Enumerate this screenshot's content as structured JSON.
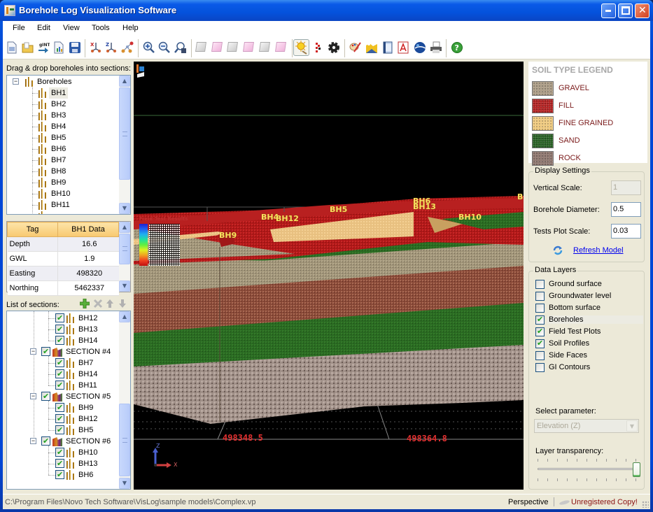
{
  "window": {
    "title": "Borehole Log Visualization Software",
    "minimize": "_",
    "maximize": "□",
    "close": "✕"
  },
  "menu": [
    "File",
    "Edit",
    "View",
    "Tools",
    "Help"
  ],
  "toolbar": {
    "icons": [
      "new-file-icon",
      "open-folder-icon",
      "import-gint-icon",
      "report-icon",
      "save-icon",
      "x-section-icon",
      "z-section-icon",
      "network-icon",
      "zoom-in-icon",
      "zoom-out-icon",
      "zoom-extents-icon",
      "view-cube-front-icon",
      "view-cube-back-icon",
      "view-cube-left-icon",
      "view-cube-right-icon",
      "view-cube-top-icon",
      "view-cube-bottom-icon",
      "lighting-icon",
      "field-plot-icon",
      "settings-gear-icon",
      "palette-brush-icon",
      "export-image-icon",
      "export-video-icon",
      "export-pdf-icon",
      "google-earth-icon",
      "print-icon",
      "help-icon"
    ]
  },
  "left": {
    "boreholes_label": "Drag & drop boreholes into sections:",
    "tree_root": "Boreholes",
    "boreholes": [
      "BH1",
      "BH2",
      "BH3",
      "BH4",
      "BH5",
      "BH6",
      "BH7",
      "BH8",
      "BH9",
      "BH10",
      "BH11"
    ],
    "selected_borehole": "BH1",
    "props": {
      "headers": [
        "Tag",
        "BH1 Data"
      ],
      "rows": [
        {
          "tag": "Depth",
          "value": "16.6"
        },
        {
          "tag": "GWL",
          "value": "1.9"
        },
        {
          "tag": "Easting",
          "value": "498320"
        },
        {
          "tag": "Northing",
          "value": "5462337"
        }
      ]
    },
    "sections_label": "List of sections:",
    "sections_tree": [
      {
        "type": "bh",
        "label": "BH12",
        "checked": true
      },
      {
        "type": "bh",
        "label": "BH13",
        "checked": true
      },
      {
        "type": "bh",
        "label": "BH14",
        "checked": true
      },
      {
        "type": "section",
        "label": "SECTION #4",
        "checked": true
      },
      {
        "type": "bh",
        "label": "BH7",
        "checked": true
      },
      {
        "type": "bh",
        "label": "BH14",
        "checked": true
      },
      {
        "type": "bh",
        "label": "BH11",
        "checked": true
      },
      {
        "type": "section",
        "label": "SECTION #5",
        "checked": true
      },
      {
        "type": "bh",
        "label": "BH9",
        "checked": true
      },
      {
        "type": "bh",
        "label": "BH12",
        "checked": true
      },
      {
        "type": "bh",
        "label": "BH5",
        "checked": true
      },
      {
        "type": "section",
        "label": "SECTION #6",
        "checked": true
      },
      {
        "type": "bh",
        "label": "BH10",
        "checked": true
      },
      {
        "type": "bh",
        "label": "BH13",
        "checked": true
      },
      {
        "type": "bh",
        "label": "BH6",
        "checked": true
      }
    ]
  },
  "viewport": {
    "field_test_title": "Field Test Results",
    "borehole_labels": [
      "BH9",
      "BH4",
      "BH12",
      "BH5",
      "BH6",
      "BH13",
      "BH10",
      "B"
    ],
    "easting_labels": [
      "498348.5",
      "498364.8"
    ],
    "axis": {
      "z": "Z",
      "x": "X"
    },
    "colorbar": [
      "#2020d0",
      "#2060f0",
      "#20b0f0",
      "#20e0a0",
      "#60f040",
      "#e0f020",
      "#f0a020",
      "#f04020",
      "#c01010"
    ]
  },
  "legend": {
    "title": "SOIL TYPE LEGEND",
    "items": [
      {
        "label": "GRAVEL",
        "color": "#a89880"
      },
      {
        "label": "FILL",
        "color": "#b01818"
      },
      {
        "label": "FINE GRAINED",
        "color": "#f0c878"
      },
      {
        "label": "SAND",
        "color": "#1e5a1a"
      },
      {
        "label": "ROCK",
        "color": "#8a7068"
      }
    ]
  },
  "display_settings": {
    "title": "Display Settings",
    "vertical_scale_label": "Vertical Scale:",
    "vertical_scale": "1",
    "borehole_diameter_label": "Borehole Diameter:",
    "borehole_diameter": "0.5",
    "tests_plot_scale_label": "Tests Plot Scale:",
    "tests_plot_scale": "0.03",
    "refresh_label": "Refresh Model"
  },
  "data_layers": {
    "title": "Data Layers",
    "items": [
      {
        "label": "Ground surface",
        "checked": false
      },
      {
        "label": "Groundwater level",
        "checked": false
      },
      {
        "label": "Bottom surface",
        "checked": false
      },
      {
        "label": "Boreholes",
        "checked": true
      },
      {
        "label": "Field Test Plots",
        "checked": true
      },
      {
        "label": "Soil Profiles",
        "checked": true
      },
      {
        "label": "Side Faces",
        "checked": false
      },
      {
        "label": "GI Contours",
        "checked": false
      }
    ],
    "select_parameter_label": "Select parameter:",
    "select_parameter_value": "Elevation (Z)",
    "transparency_label": "Layer transparency:",
    "transparency_value": 1.0
  },
  "status": {
    "path": "C:\\Program Files\\Novo Tech Software\\VisLog\\sample models\\Complex.vp",
    "mode": "Perspective",
    "registration": "Unregistered Copy!"
  }
}
